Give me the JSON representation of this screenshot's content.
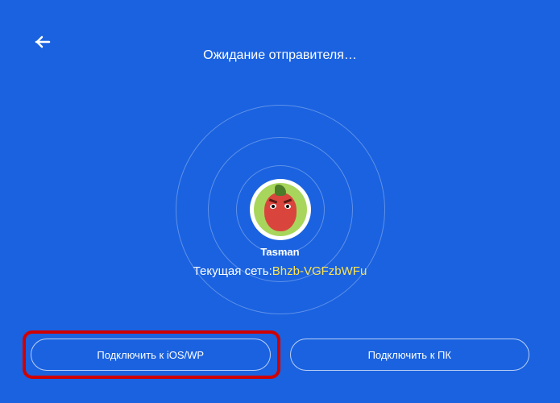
{
  "header": {
    "title": "Ожидание отправителя…"
  },
  "avatar": {
    "username": "Tasman"
  },
  "network": {
    "label": "Текущая сеть:",
    "value": "Bhzb-VGFzbWFu"
  },
  "buttons": {
    "connect_ios": "Подключить к iOS/WP",
    "connect_pc": "Подключить к ПК"
  }
}
